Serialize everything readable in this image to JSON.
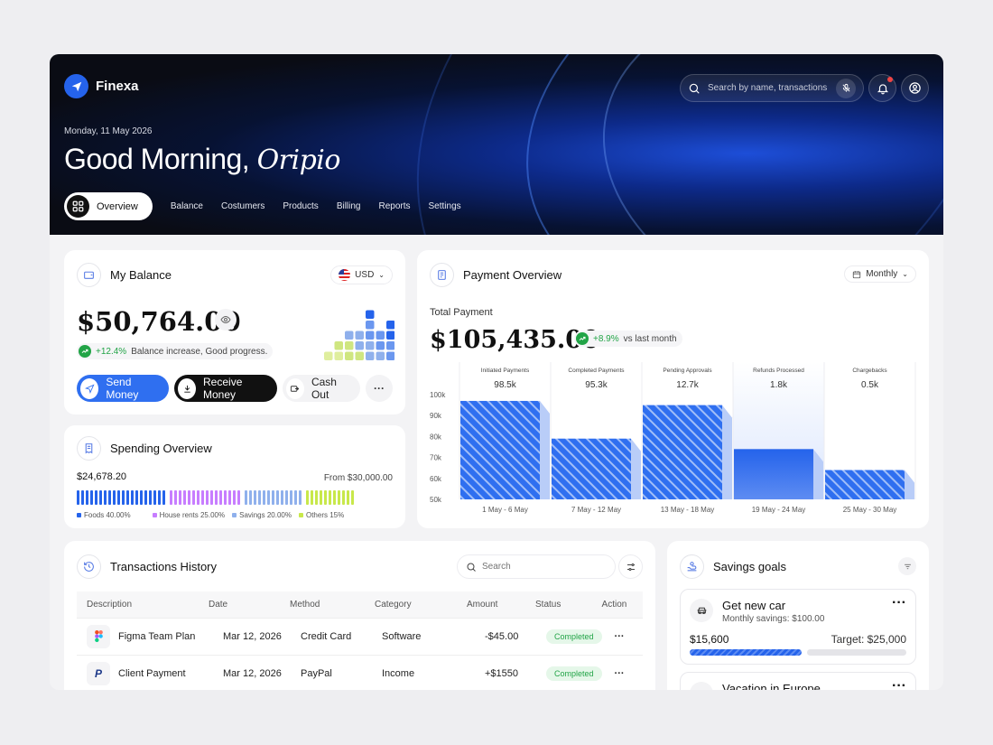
{
  "app": {
    "name": "Finexa"
  },
  "header": {
    "date": "Monday, 11 May 2026",
    "greeting": "Good Morning,",
    "user_name": "Oripio",
    "search_placeholder": "Search by name, transactions",
    "tabs": [
      {
        "label": "Overview",
        "active": true
      },
      {
        "label": "Balance"
      },
      {
        "label": "Costumers"
      },
      {
        "label": "Products"
      },
      {
        "label": "Billing"
      },
      {
        "label": "Reports"
      },
      {
        "label": "Settings"
      }
    ]
  },
  "balance": {
    "title": "My Balance",
    "currency": "USD",
    "amount": "$50,764.00",
    "change": "+12.4%",
    "change_note": "Balance increase, Good progress.",
    "send_label": "Send Money",
    "receive_label": "Receive Money",
    "cashout_label": "Cash Out",
    "more_label": "···"
  },
  "spending": {
    "title": "Spending Overview",
    "spent": "$24,678.20",
    "limit": "From $30,000.00",
    "categories": [
      {
        "name": "Foods",
        "pct": "40.00%",
        "color": "#2563eb"
      },
      {
        "name": "House rents",
        "pct": "25.00%",
        "color": "#c77dff"
      },
      {
        "name": "Savings",
        "pct": "20.00%",
        "color": "#8fb0ec"
      },
      {
        "name": "Others",
        "pct": "15%",
        "color": "#c8e84a"
      }
    ]
  },
  "payment": {
    "title": "Payment Overview",
    "period": "Monthly",
    "total_label": "Total Payment",
    "total": "$105,435.00",
    "change": "+8.9%",
    "change_note": "vs last month"
  },
  "chart_data": {
    "type": "bar",
    "categories": [
      "1 May - 6 May",
      "7 May - 12 May",
      "13 May - 18 May",
      "19 May - 24 May",
      "25 May - 30 May"
    ],
    "column_titles": [
      "Initiated Payments",
      "Completed Payments",
      "Pending Approvals",
      "Refunds Processed",
      "Chargebacks"
    ],
    "column_values": [
      "98.5k",
      "95.3k",
      "12.7k",
      "1.8k",
      "0.5k"
    ],
    "values": [
      97,
      79,
      95,
      74,
      64
    ],
    "highlighted_index": 3,
    "ylim": [
      50,
      100
    ],
    "yticks": [
      100,
      90,
      80,
      70,
      60,
      50
    ],
    "ytick_labels": [
      "100k",
      "90k",
      "80k",
      "70k",
      "60k",
      "50k"
    ],
    "color": "#2563eb"
  },
  "transactions": {
    "title": "Transactions History",
    "search_placeholder": "Search",
    "columns": [
      "Description",
      "Date",
      "Method",
      "Category",
      "Amount",
      "Status",
      "Action"
    ],
    "rows": [
      {
        "description": "Figma Team Plan",
        "date": "Mar 12, 2026",
        "method": "Credit Card",
        "category": "Software",
        "amount": "-$45.00",
        "status": "Completed",
        "icon": "figma-icon"
      },
      {
        "description": "Client Payment",
        "date": "Mar 12, 2026",
        "method": "PayPal",
        "category": "Income",
        "amount": "+$1550",
        "status": "Completed",
        "icon": "paypal-icon"
      }
    ]
  },
  "savings": {
    "title": "Savings goals",
    "goals": [
      {
        "name": "Get new car",
        "monthly": "Monthly savings: $100.00",
        "saved": "$15,600",
        "target": "Target: $25,000",
        "progress": 0.48
      },
      {
        "name": "Vacation in Europe"
      }
    ]
  }
}
